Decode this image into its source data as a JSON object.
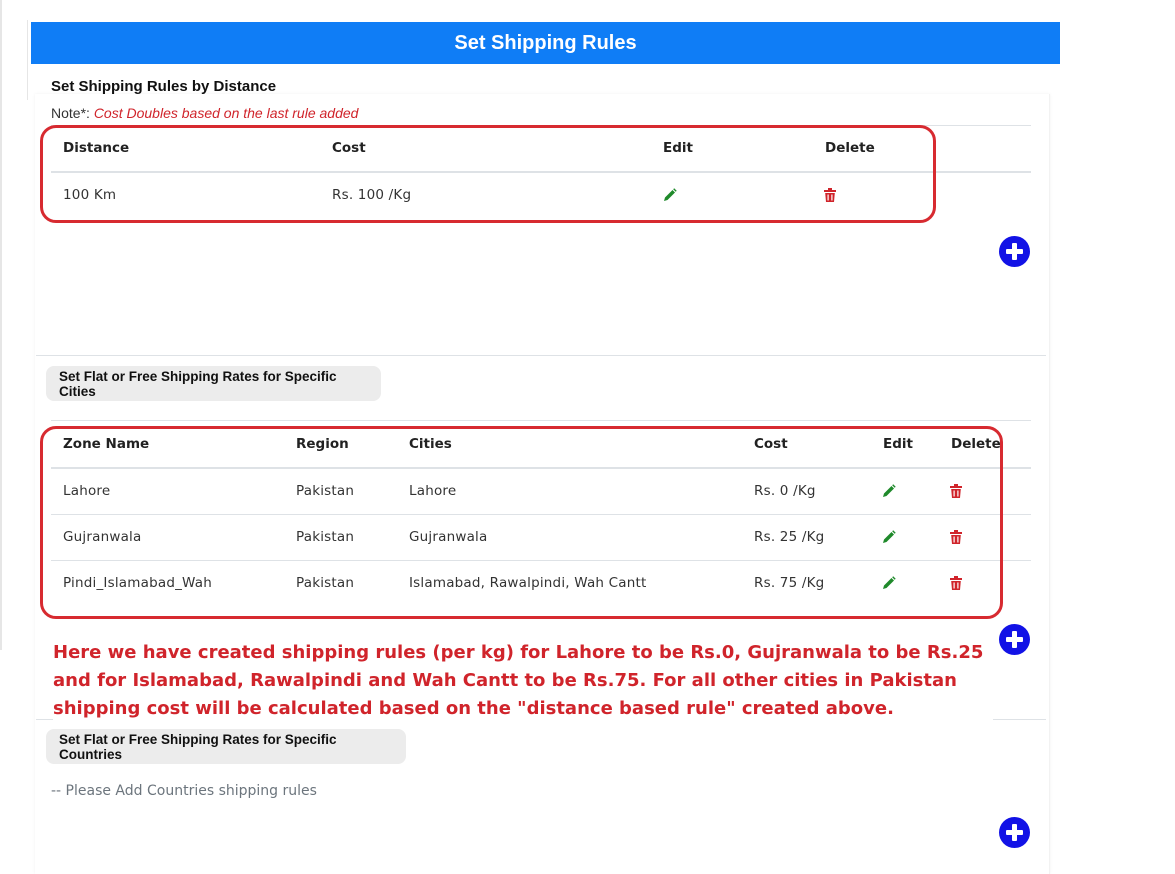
{
  "header": {
    "title": "Set Shipping Rules"
  },
  "distance_section": {
    "title": "Set Shipping Rules by Distance",
    "note_label": "Note*:",
    "note_text": "Cost Doubles based on the last rule added",
    "columns": [
      "Distance",
      "Cost",
      "Edit",
      "Delete"
    ],
    "rows": [
      {
        "distance": "100 Km",
        "cost": "Rs. 100 /Kg"
      }
    ]
  },
  "cities_section": {
    "button_label": "Set Flat or Free Shipping Rates for Specific Cities",
    "columns": [
      "Zone Name",
      "Region",
      "Cities",
      "Cost",
      "Edit",
      "Delete"
    ],
    "rows": [
      {
        "zone": "Lahore",
        "region": "Pakistan",
        "cities": "Lahore",
        "cost": "Rs. 0 /Kg"
      },
      {
        "zone": "Gujranwala",
        "region": "Pakistan",
        "cities": "Gujranwala",
        "cost": "Rs. 25 /Kg"
      },
      {
        "zone": "Pindi_Islamabad_Wah",
        "region": "Pakistan",
        "cities": "Islamabad, Rawalpindi, Wah Cantt",
        "cost": "Rs. 75 /Kg"
      }
    ]
  },
  "annotation": {
    "text": "Here we have created shipping rules (per kg) for Lahore to be Rs.0, Gujranwala to be Rs.25 and for Islamabad, Rawalpindi and Wah Cantt to be Rs.75. For all other cities in Pakistan shipping cost will be calculated based on the \"distance based rule\" created above."
  },
  "countries_section": {
    "button_label": "Set Flat or Free Shipping Rates for Specific Countries",
    "empty_message": "-- Please Add Countries shipping rules"
  },
  "colors": {
    "header_bg": "#0f7df6",
    "highlight_red": "#d72a30",
    "edit_green": "#1f8a2b",
    "delete_red": "#d0242b",
    "add_blue": "#1212e6"
  },
  "icons": {
    "edit": "pencil-icon",
    "delete": "trash-icon",
    "add": "plus-circle-icon"
  }
}
